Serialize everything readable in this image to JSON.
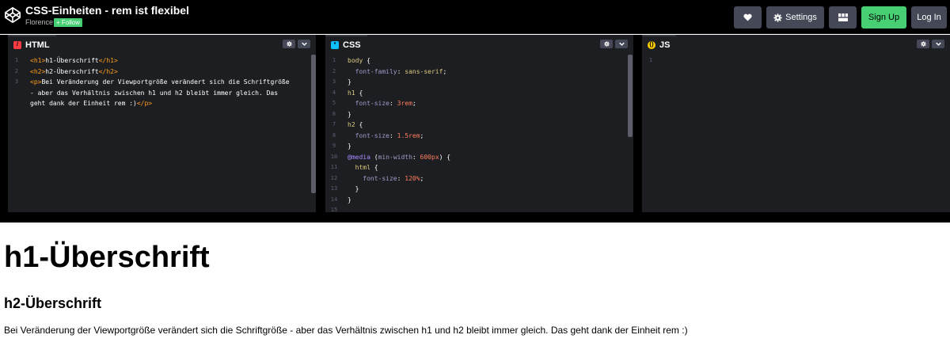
{
  "header": {
    "title": "CSS-Einheiten - rem ist flexibel",
    "author": "Florence",
    "follow_label": "+ Follow",
    "settings_label": "Settings",
    "signup_label": "Sign Up",
    "login_label": "Log In",
    "icons": [
      "codepen-logo-icon",
      "heart-icon",
      "gear-icon",
      "layout-icon"
    ]
  },
  "editors": {
    "html": {
      "tab": "HTML",
      "icon": "/"
    },
    "css": {
      "tab": "CSS",
      "icon": "*"
    },
    "js": {
      "tab": "JS",
      "icon": "{}"
    }
  },
  "html_code": [
    [
      {
        "c": "t-tag",
        "t": "<h1>"
      },
      {
        "c": "t-txt",
        "t": "h1-Überschrift"
      },
      {
        "c": "t-tag",
        "t": "</h1>"
      }
    ],
    [
      {
        "c": "t-tag",
        "t": "<h2>"
      },
      {
        "c": "t-txt",
        "t": "h2-Überschrift"
      },
      {
        "c": "t-tag",
        "t": "</h2>"
      }
    ],
    [
      {
        "c": "t-tag",
        "t": "<p>"
      },
      {
        "c": "t-txt",
        "t": "Bei Veränderung der Viewportgröße verändert sich die Schriftgröße"
      }
    ],
    [
      {
        "c": "t-txt",
        "t": "- aber das Verhältnis zwischen h1 und h2 bleibt immer gleich. Das"
      }
    ],
    [
      {
        "c": "t-txt",
        "t": "geht dank der Einheit rem :)"
      },
      {
        "c": "t-tag",
        "t": "</p>"
      }
    ]
  ],
  "html_line_numbers": [
    "1",
    "2",
    "3",
    "",
    ""
  ],
  "css_code": [
    [
      {
        "c": "t-sel",
        "t": "body"
      },
      {
        "c": "t-pun",
        "t": " {"
      }
    ],
    [
      {
        "c": "t-prop",
        "t": "  font-family"
      },
      {
        "c": "t-pun",
        "t": ": "
      },
      {
        "c": "t-sel",
        "t": "sans-serif"
      },
      {
        "c": "t-pun",
        "t": ";"
      }
    ],
    [
      {
        "c": "t-pun",
        "t": "}"
      }
    ],
    [
      {
        "c": "t-sel",
        "t": "h1"
      },
      {
        "c": "t-pun",
        "t": " {"
      }
    ],
    [
      {
        "c": "t-prop",
        "t": "  font-size"
      },
      {
        "c": "t-pun",
        "t": ": "
      },
      {
        "c": "t-unit",
        "t": "3rem"
      },
      {
        "c": "t-pun",
        "t": ";"
      }
    ],
    [
      {
        "c": "t-pun",
        "t": "}"
      }
    ],
    [
      {
        "c": "t-sel",
        "t": "h2"
      },
      {
        "c": "t-pun",
        "t": " {"
      }
    ],
    [
      {
        "c": "t-prop",
        "t": "  font-size"
      },
      {
        "c": "t-pun",
        "t": ": "
      },
      {
        "c": "t-unit",
        "t": "1.5rem"
      },
      {
        "c": "t-pun",
        "t": ";"
      }
    ],
    [
      {
        "c": "t-pun",
        "t": "}"
      }
    ],
    [
      {
        "c": "t-at",
        "t": "@media"
      },
      {
        "c": "t-pun",
        "t": " ("
      },
      {
        "c": "t-prop",
        "t": "min-width"
      },
      {
        "c": "t-pun",
        "t": ": "
      },
      {
        "c": "t-unit",
        "t": "600px"
      },
      {
        "c": "t-pun",
        "t": ") {"
      }
    ],
    [
      {
        "c": "t-sel",
        "t": "  html"
      },
      {
        "c": "t-pun",
        "t": " {"
      }
    ],
    [
      {
        "c": "t-prop",
        "t": "    font-size"
      },
      {
        "c": "t-pun",
        "t": ": "
      },
      {
        "c": "t-unit",
        "t": "120%"
      },
      {
        "c": "t-pun",
        "t": ";"
      }
    ],
    [
      {
        "c": "t-pun",
        "t": "  }"
      }
    ],
    [
      {
        "c": "t-pun",
        "t": "}"
      }
    ],
    [
      {
        "c": "t-pun",
        "t": ""
      }
    ]
  ],
  "css_line_numbers": [
    "1",
    "2",
    "3",
    "4",
    "5",
    "6",
    "7",
    "8",
    "9",
    "10",
    "11",
    "12",
    "13",
    "14",
    "15"
  ],
  "js_line_numbers": [
    "1"
  ],
  "preview": {
    "h1": "h1-Überschrift",
    "h2": "h2-Überschrift",
    "p": "Bei Veränderung der Viewportgröße verändert sich die Schriftgröße - aber das Verhältnis zwischen h1 und h2 bleibt immer gleich. Das geht dank der Einheit rem :)"
  },
  "colors": {
    "background": "#000000",
    "editor_bg": "#1d1e22",
    "button_bg": "#444857",
    "accent_green": "#47cf73",
    "html_icon": "#ff3c41",
    "css_icon": "#0ebeff",
    "js_icon": "#fcd000"
  }
}
